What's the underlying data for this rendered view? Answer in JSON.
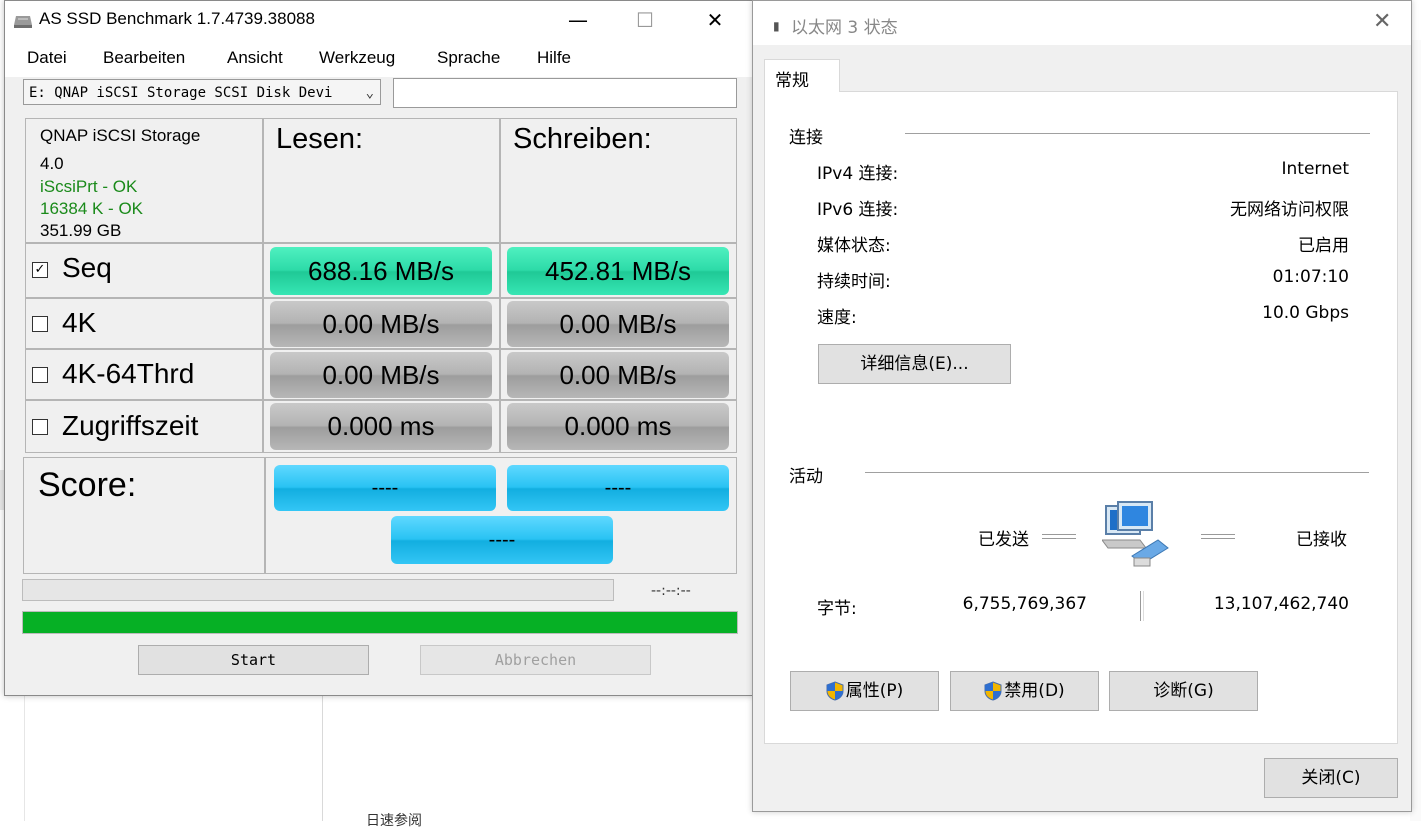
{
  "asssd": {
    "title": "AS SSD Benchmark 1.7.4739.38088",
    "window_controls": {
      "minimize": "—",
      "maximize": "☐",
      "close": "✕"
    },
    "menu": [
      "Datei",
      "Bearbeiten",
      "Ansicht",
      "Werkzeug",
      "Sprache",
      "Hilfe"
    ],
    "drive_select": "E: QNAP iSCSI Storage SCSI Disk Devi",
    "drive_info": {
      "model": "QNAP iSCSI Storage",
      "firmware": "4.0",
      "driver_status": "iScsiPrt - OK",
      "alignment_status": "16384 K - OK",
      "capacity": "351.99 GB"
    },
    "columns": {
      "read": "Lesen:",
      "write": "Schreiben:"
    },
    "rows": [
      {
        "label": "Seq",
        "checked": true,
        "read": "688.16 MB/s",
        "write": "452.81 MB/s"
      },
      {
        "label": "4K",
        "checked": false,
        "read": "0.00 MB/s",
        "write": "0.00 MB/s"
      },
      {
        "label": "4K-64Thrd",
        "checked": false,
        "read": "0.00 MB/s",
        "write": "0.00 MB/s"
      },
      {
        "label": "Zugriffszeit",
        "checked": false,
        "read": "0.000 ms",
        "write": "0.000 ms"
      }
    ],
    "score": {
      "label": "Score:",
      "read": "----",
      "write": "----",
      "total": "----"
    },
    "progress": {
      "time": "--:--:--",
      "bar_fraction": 1.0
    },
    "buttons": {
      "start": "Start",
      "abort": "Abbrechen"
    },
    "colors": {
      "result_green": "#2ddba8",
      "result_gray": "#b3b3b3",
      "score_blue": "#29c3f3",
      "progress_green": "#06b025",
      "ok_text": "#1a8a1a"
    }
  },
  "ethernet": {
    "title": "以太网 3 状态",
    "tab": "常规",
    "connection": {
      "section": "连接",
      "items": [
        {
          "key": "IPv4 连接:",
          "value": "Internet"
        },
        {
          "key": "IPv6 连接:",
          "value": "无网络访问权限"
        },
        {
          "key": "媒体状态:",
          "value": "已启用"
        },
        {
          "key": "持续时间:",
          "value": "01:07:10"
        },
        {
          "key": "速度:",
          "value": "10.0 Gbps"
        }
      ],
      "details_button": "详细信息(E)..."
    },
    "activity": {
      "section": "活动",
      "sent_label": "已发送",
      "received_label": "已接收",
      "bytes_label": "字节:",
      "bytes_sent": "6,755,769,367",
      "bytes_received": "13,107,462,740"
    },
    "buttons": {
      "properties": "属性(P)",
      "disable": "禁用(D)",
      "diagnose": "诊断(G)",
      "close": "关闭(C)"
    }
  },
  "background": {
    "cut_text": "日速参阅"
  }
}
